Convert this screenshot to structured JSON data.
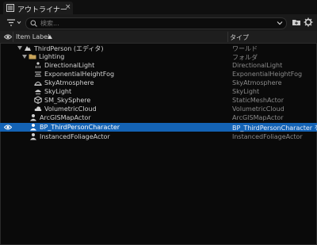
{
  "tab": {
    "title": "アウトライナー",
    "close": "×"
  },
  "search": {
    "placeholder": "検索..."
  },
  "header": {
    "label_col": "Item Label",
    "type_col": "タイプ"
  },
  "rows": [
    {
      "name": "ThirdPerson (エディタ)",
      "type": "ワールド",
      "icon": "world-icon"
    },
    {
      "name": "Lighting",
      "type": "フォルダ",
      "icon": "folder-icon"
    },
    {
      "name": "DirectionalLight",
      "type": "DirectionalLight",
      "icon": "directional-light-icon"
    },
    {
      "name": "ExponentialHeightFog",
      "type": "ExponentialHeightFog",
      "icon": "fog-icon"
    },
    {
      "name": "SkyAtmosphere",
      "type": "SkyAtmosphere",
      "icon": "sky-atmosphere-icon"
    },
    {
      "name": "SkyLight",
      "type": "SkyLight",
      "icon": "skylight-icon"
    },
    {
      "name": "SM_SkySphere",
      "type": "StaticMeshActor",
      "icon": "static-mesh-icon"
    },
    {
      "name": "VolumetricCloud",
      "type": "VolumetricCloud",
      "icon": "cloud-icon"
    },
    {
      "name": "ArcGISMapActor",
      "type": "ArcGISMapActor",
      "icon": "actor-icon"
    },
    {
      "name": "BP_ThirdPersonCharacter",
      "type": "BP_ThirdPersonCharacter を",
      "icon": "character-icon",
      "selected": true
    },
    {
      "name": "InstancedFoliageActor",
      "type": "InstancedFoliageActor",
      "icon": "actor-icon"
    }
  ],
  "colors": {
    "selection": "#1463b5",
    "folder": "#c8a45a",
    "background": "#0a0a0a"
  }
}
